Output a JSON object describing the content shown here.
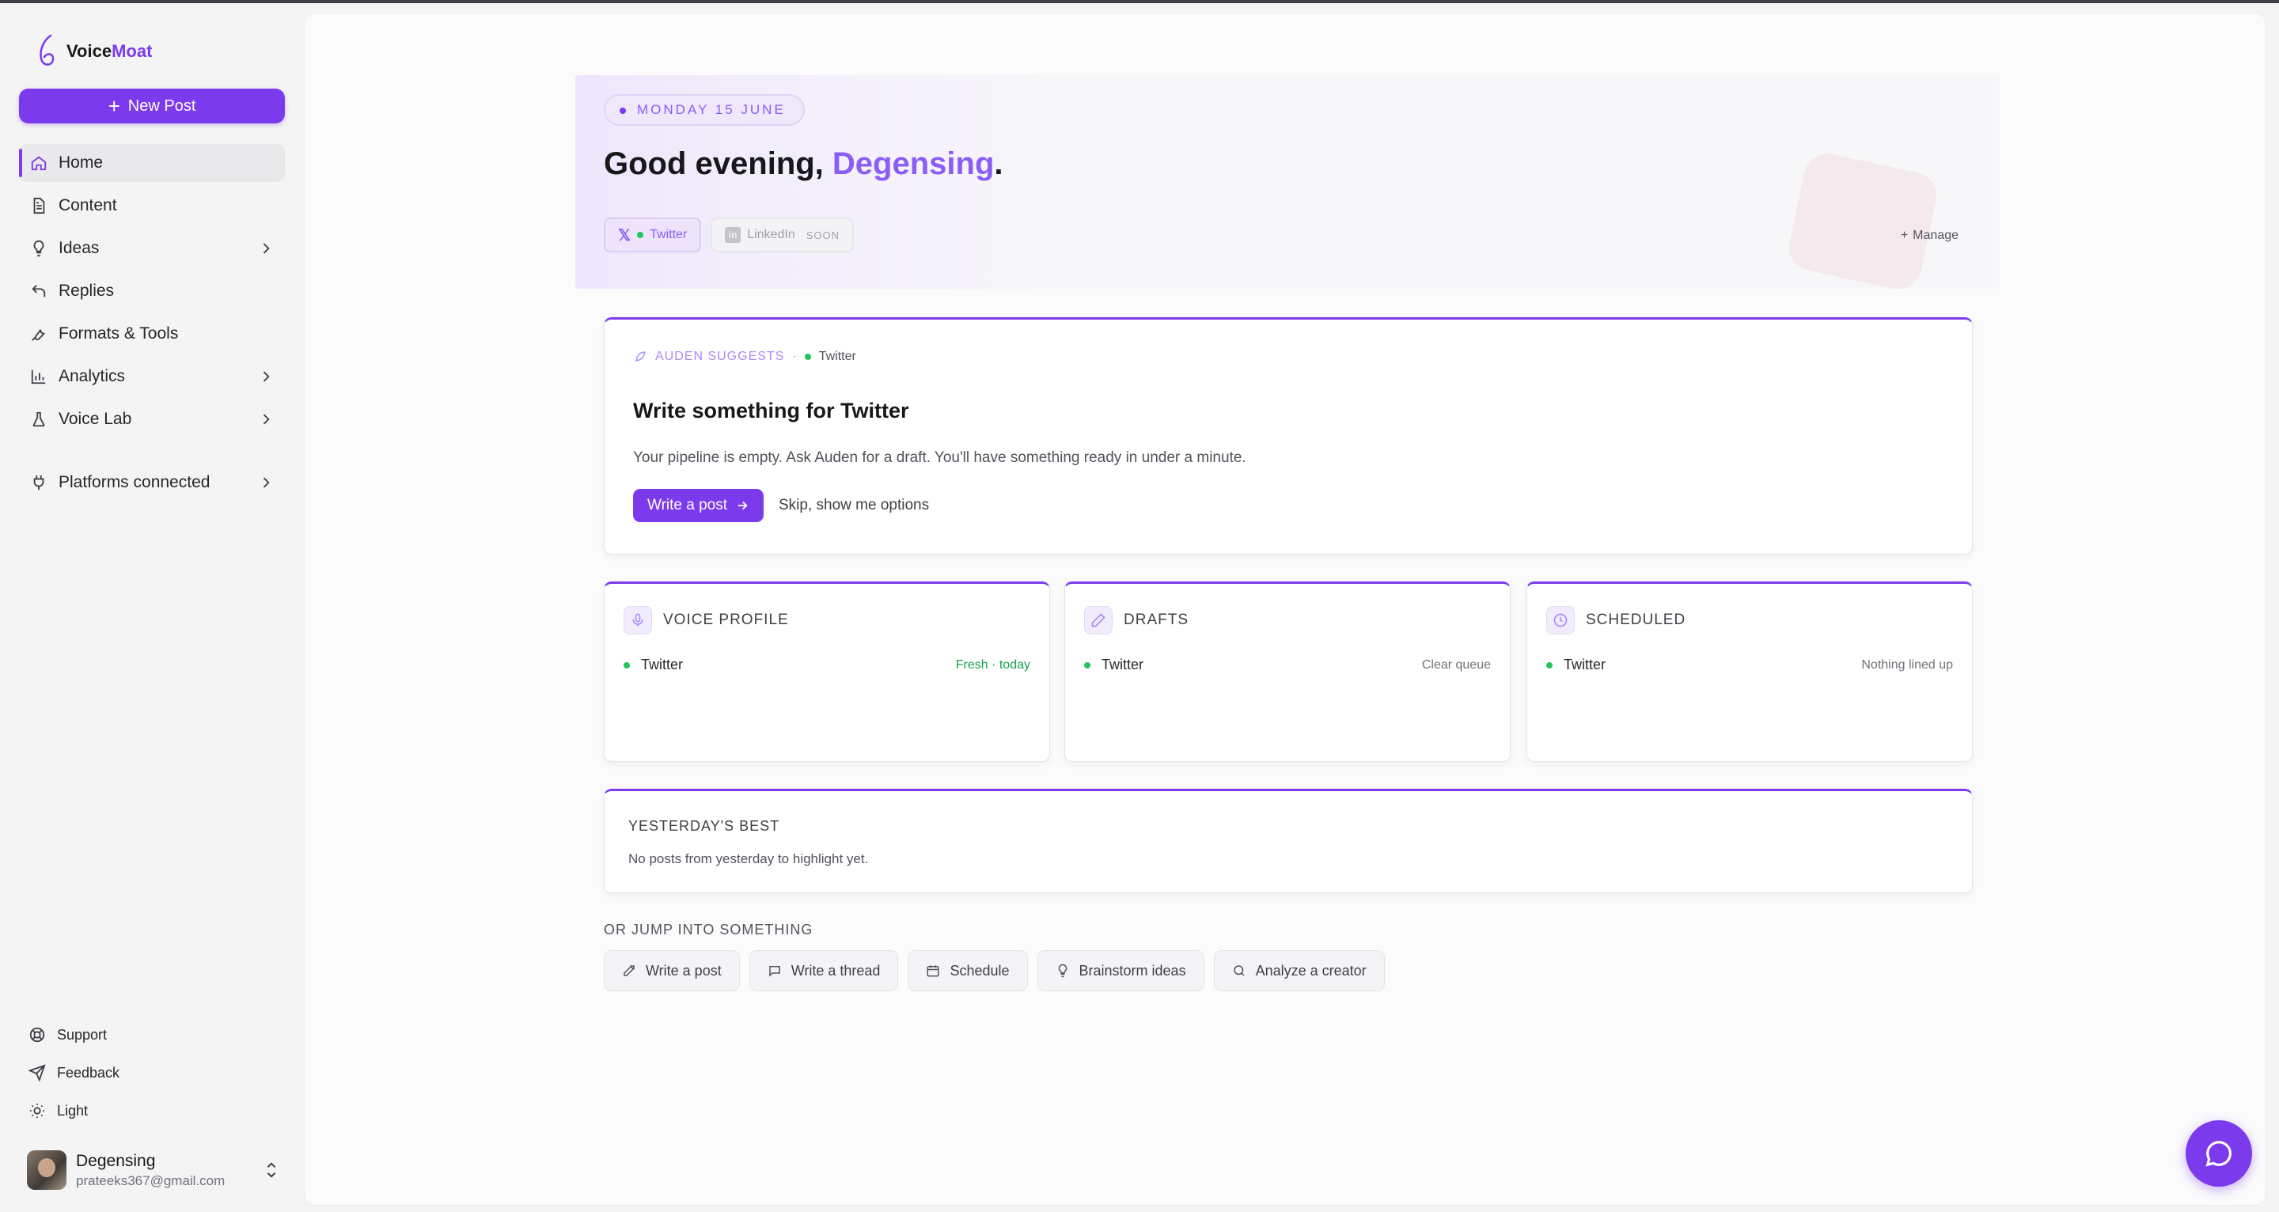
{
  "brand": {
    "name_part1": "Voice",
    "name_part2": "Moat"
  },
  "sidebar": {
    "new_post_label": "New Post",
    "items": [
      {
        "label": "Home",
        "icon": "home-icon",
        "active": true
      },
      {
        "label": "Content",
        "icon": "document-icon"
      },
      {
        "label": "Ideas",
        "icon": "lightbulb-icon",
        "expandable": true
      },
      {
        "label": "Replies",
        "icon": "reply-icon"
      },
      {
        "label": "Formats & Tools",
        "icon": "wrench-icon"
      },
      {
        "label": "Analytics",
        "icon": "bar-chart-icon",
        "expandable": true
      },
      {
        "label": "Voice Lab",
        "icon": "flask-icon",
        "expandable": true
      }
    ],
    "platforms_label": "Platforms connected",
    "bottom": {
      "support": "Support",
      "feedback": "Feedback",
      "theme": "Light"
    },
    "user": {
      "name": "Degensing",
      "email": "prateeks367@gmail.com"
    }
  },
  "hero": {
    "date": "MONDAY 15 JUNE",
    "greeting": "Good evening, ",
    "name": "Degensing",
    "punct": ".",
    "tabs": [
      {
        "label": "Twitter",
        "active": true
      },
      {
        "label": "LinkedIn",
        "badge": "SOON"
      }
    ],
    "manage_label": "Manage"
  },
  "suggestion": {
    "label": "AUDEN SUGGESTS",
    "separator": "·",
    "platform": "Twitter",
    "title": "Write something for Twitter",
    "description": "Your pipeline is empty. Ask Auden for a draft. You'll have something ready in under a minute.",
    "primary_action": "Write a post",
    "secondary_action": "Skip, show me options"
  },
  "stats": {
    "voice": {
      "title": "VOICE PROFILE",
      "platform": "Twitter",
      "status": "Fresh · today"
    },
    "drafts": {
      "title": "DRAFTS",
      "platform": "Twitter",
      "status": "Clear queue"
    },
    "scheduled": {
      "title": "SCHEDULED",
      "platform": "Twitter",
      "status": "Nothing lined up"
    }
  },
  "best": {
    "title": "YESTERDAY'S BEST",
    "description": "No posts from yesterday to highlight yet."
  },
  "jump": {
    "label": "OR JUMP INTO SOMETHING",
    "actions": [
      "Write a post",
      "Write a thread",
      "Schedule",
      "Brainstorm ideas",
      "Analyze a creator"
    ]
  },
  "colors": {
    "accent": "#7c3aed",
    "accent_light": "#8b5cf6",
    "success": "#22c55e"
  }
}
